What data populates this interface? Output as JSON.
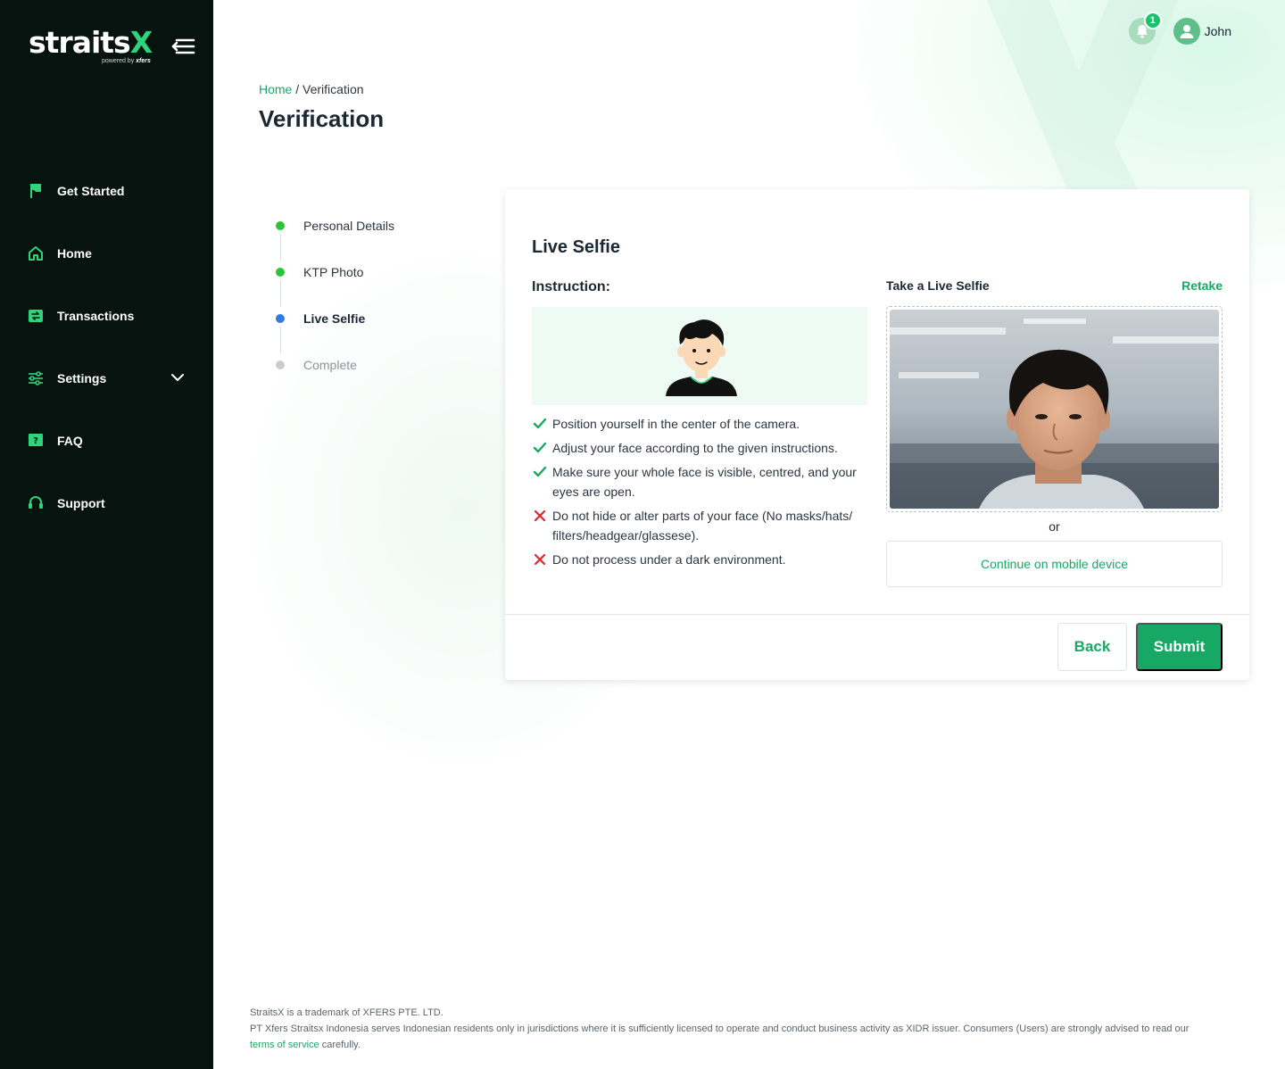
{
  "brand": {
    "logo_text": "straits",
    "logo_x": "X",
    "logo_sub_prefix": "powered by ",
    "logo_sub_brand": "xfers",
    "accent": "#18a865",
    "sidebar_bg": "#07130f"
  },
  "sidebar": {
    "items": [
      {
        "label": "Get Started",
        "icon": "flag-icon"
      },
      {
        "label": "Home",
        "icon": "home-icon"
      },
      {
        "label": "Transactions",
        "icon": "transactions-icon"
      },
      {
        "label": "Settings",
        "icon": "sliders-icon"
      },
      {
        "label": "FAQ",
        "icon": "question-icon"
      },
      {
        "label": "Support",
        "icon": "headset-icon"
      }
    ]
  },
  "header": {
    "notification_count": "1",
    "username": "John"
  },
  "breadcrumb": {
    "home": "Home",
    "separator": " / ",
    "current": "Verification"
  },
  "page_title": "Verification",
  "steps": [
    {
      "label": "Personal Details",
      "status": "done",
      "color": "#2ec43a"
    },
    {
      "label": "KTP Photo",
      "status": "done",
      "color": "#2ec43a"
    },
    {
      "label": "Live Selfie",
      "status": "active",
      "color": "#2f7be0"
    },
    {
      "label": "Complete",
      "status": "pending",
      "color": "#cccccc"
    }
  ],
  "card": {
    "title": "Live Selfie",
    "instruction_title": "Instruction:",
    "instructions": [
      {
        "text": "Position yourself in the center of the camera.",
        "ok": true
      },
      {
        "text": "Adjust your face according to the given instructions.",
        "ok": true
      },
      {
        "text": "Make sure your whole face is visible, centred, and your eyes are open.",
        "ok": true
      },
      {
        "text": "Do not hide or alter parts of your face (No masks/hats/ filters/headgear/glassese).",
        "ok": false
      },
      {
        "text": "Do not process under a dark environment.",
        "ok": false
      }
    ],
    "selfie_title": "Take a Live Selfie",
    "retake": "Retake",
    "or": "or",
    "mobile_button": "Continue on mobile device",
    "back_button": "Back",
    "submit_button": "Submit"
  },
  "footer": {
    "line1": "StraitsX is a trademark of XFERS PTE. LTD.",
    "line2": "PT Xfers Straitsx Indonesia serves Indonesian residents only in jurisdictions where it is sufficiently licensed to operate and conduct business activity as XIDR issuer. Consumers (Users) are strongly advised to read our",
    "tos_link": "terms of service",
    "line3_suffix": " carefully."
  }
}
